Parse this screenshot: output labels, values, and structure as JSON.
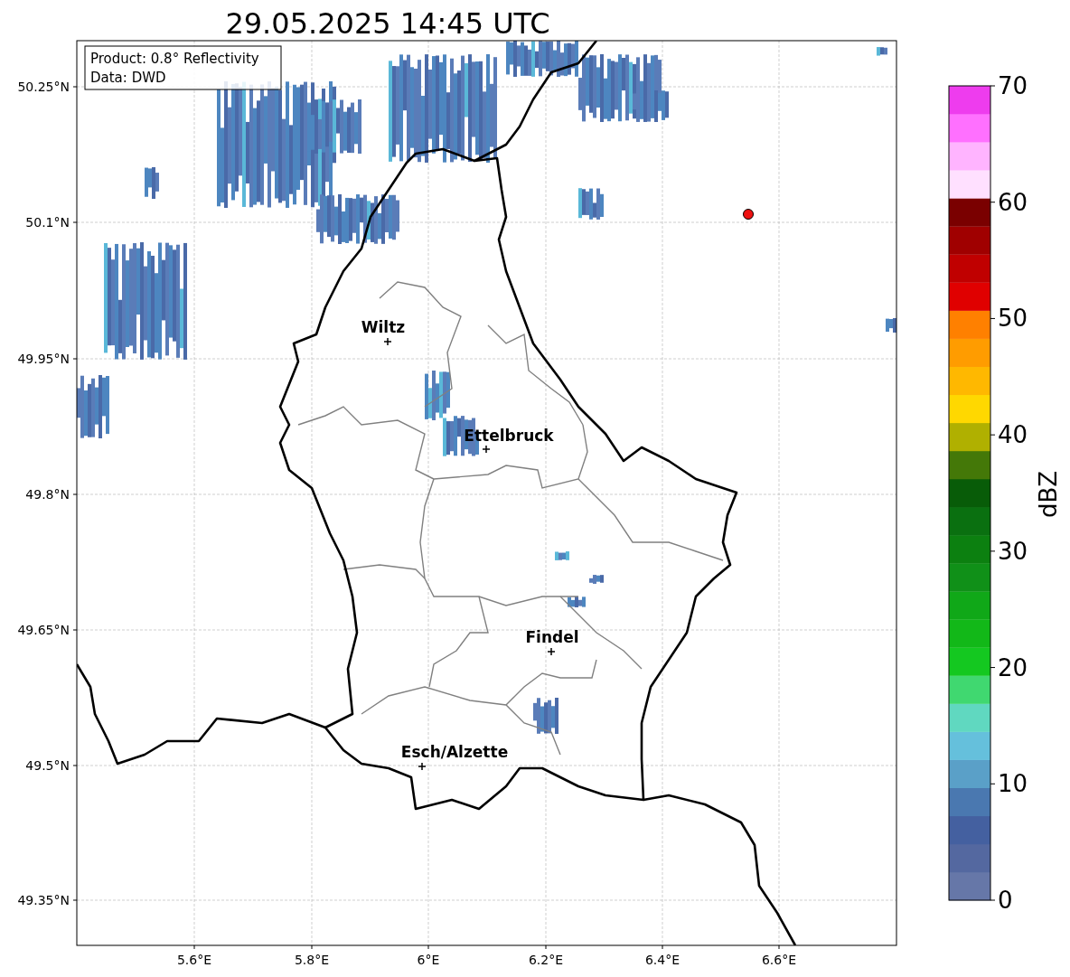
{
  "title": "29.05.2025 14:45 UTC",
  "info": [
    "Product: 0.8° Reflectivity",
    "Data: DWD"
  ],
  "x_ticks": [
    "5.6°E",
    "5.8°E",
    "6°E",
    "6.2°E",
    "6.4°E",
    "6.6°E"
  ],
  "y_ticks": [
    "50.25°N",
    "50.1°N",
    "49.95°N",
    "49.8°N",
    "49.65°N",
    "49.5°N",
    "49.35°N"
  ],
  "cities": [
    {
      "label": "Wiltz"
    },
    {
      "label": "Ettelbruck"
    },
    {
      "label": "Findel"
    },
    {
      "label": "Esch/Alzette"
    }
  ],
  "colorbar": {
    "label": "dBZ",
    "ticks": [
      "70",
      "60",
      "50",
      "40",
      "30",
      "20",
      "10",
      "0"
    ],
    "segments": [
      {
        "color": "#6677a8"
      },
      {
        "color": "#5468a0"
      },
      {
        "color": "#4460a0"
      },
      {
        "color": "#4a78b0"
      },
      {
        "color": "#5aa0c8"
      },
      {
        "color": "#65c0dc"
      },
      {
        "color": "#60d8c0"
      },
      {
        "color": "#40d870"
      },
      {
        "color": "#14c820"
      },
      {
        "color": "#12b818"
      },
      {
        "color": "#10a818"
      },
      {
        "color": "#109018"
      },
      {
        "color": "#0c8010"
      },
      {
        "color": "#0a7010"
      },
      {
        "color": "#085c08"
      },
      {
        "color": "#447808"
      },
      {
        "color": "#b0b000"
      },
      {
        "color": "#ffd800"
      },
      {
        "color": "#ffb800"
      },
      {
        "color": "#ff9c00"
      },
      {
        "color": "#ff8000"
      },
      {
        "color": "#e00000"
      },
      {
        "color": "#c00000"
      },
      {
        "color": "#a00000"
      },
      {
        "color": "#7a0000"
      },
      {
        "color": "#ffe0ff"
      },
      {
        "color": "#ffb4ff"
      },
      {
        "color": "#ff70ff"
      },
      {
        "color": "#ee3cee"
      }
    ]
  }
}
